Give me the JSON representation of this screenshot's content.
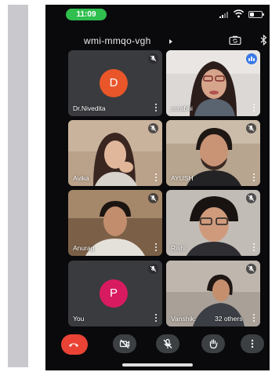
{
  "status_bar": {
    "time": "11:09"
  },
  "header": {
    "meeting_code": "wmi-mmqo-vgh"
  },
  "participants": [
    {
      "name": "Dr.Nivedita",
      "initial": "D",
      "avatar_color": "#e8562a",
      "muted": true
    },
    {
      "name": "surabhi",
      "speaking": true
    },
    {
      "name": "Avika",
      "muted": true
    },
    {
      "name": "AYUSH",
      "muted": true
    },
    {
      "name": "Anurag",
      "muted": true
    },
    {
      "name": "Rishi",
      "muted": true
    },
    {
      "name": "You",
      "initial": "P",
      "avatar_color": "#d81b60",
      "muted": true
    },
    {
      "name": "Vanshik:",
      "extra": "32 others",
      "muted": true
    }
  ],
  "colors": {
    "end_call": "#ea4335",
    "time_pill": "#2fbf4f",
    "speaking": "#3b78e7",
    "tile_bg": "#3a3b3f"
  },
  "controls": [
    {
      "icon": "phone-hangup-icon"
    },
    {
      "icon": "video-off-icon"
    },
    {
      "icon": "mic-off-icon"
    },
    {
      "icon": "raise-hand-icon"
    },
    {
      "icon": "more-vertical-icon"
    }
  ]
}
